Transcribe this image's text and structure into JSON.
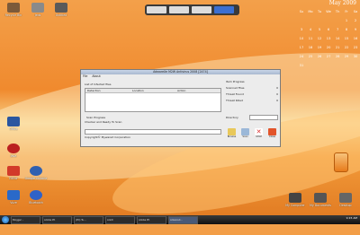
{
  "desktop": {
    "top_icons": [
      {
        "label": "Recycle Bin",
        "color": "#7c5a3a"
      },
      {
        "label": "Jeds",
        "color": "#8a8a8a"
      },
      {
        "label": "Untitled",
        "color": "#5a5a5a"
      }
    ],
    "left_icons": [
      {
        "label": "Office",
        "color": "#2a56a0"
      },
      {
        "label": "",
        "color": "#3b3b3b"
      },
      {
        "label": "",
        "color": "#3a6cc7"
      },
      {
        "label": "Vuze",
        "color": "#2a69c9"
      },
      {
        "label": "Java",
        "color": "#bb2020"
      },
      {
        "label": "Word",
        "color": "#7a7a7a"
      },
      {
        "label": "Editor",
        "color": "#d23a2a"
      },
      {
        "label": "Google Chrome",
        "color": "#3060b0"
      },
      {
        "label": "Bluetooth",
        "color": "#2f62c8"
      },
      {
        "label": "Zoom",
        "color": "#b22f2f"
      },
      {
        "label": "",
        "color": "#2d5fa7"
      }
    ],
    "bottom_right_icons": [
      {
        "label": "My Computer",
        "color": "#444"
      },
      {
        "label": "My Documents",
        "color": "#555"
      },
      {
        "label": "Desktop",
        "color": "#666"
      }
    ]
  },
  "calendar": {
    "month": "May 2009",
    "headers": [
      "Su",
      "Mo",
      "Tu",
      "We",
      "Th",
      "Fr",
      "Sa"
    ],
    "weeks": [
      [
        "",
        "",
        "",
        "",
        "",
        "1",
        "2"
      ],
      [
        "3",
        "4",
        "5",
        "6",
        "7",
        "8",
        "9"
      ],
      [
        "10",
        "11",
        "12",
        "13",
        "14",
        "15",
        "16"
      ],
      [
        "17",
        "18",
        "19",
        "20",
        "21",
        "22",
        "23"
      ],
      [
        "24",
        "25",
        "26",
        "27",
        "28",
        "29",
        "30"
      ],
      [
        "31",
        "",
        "",
        "",
        "",
        "",
        ""
      ]
    ]
  },
  "app": {
    "title": "AdwareXe M2W Antivirus 2008 [2474]",
    "menu": [
      "File",
      "About"
    ],
    "list_title": "List of Infected files",
    "columns": [
      "Detection",
      "Location",
      "Action"
    ],
    "scan_progress_label": "Scan Progress",
    "status": "Checker and Ready To Scan",
    "copyright": "Copyright© MywareX Corporation",
    "stats_title": "Item Progress",
    "stats": [
      {
        "label": "Scanned Files",
        "value": "0"
      },
      {
        "label": "Threat Found",
        "value": "0"
      },
      {
        "label": "Threat Killed",
        "value": "0"
      }
    ],
    "directory_label": "Directory",
    "buttons": [
      {
        "label": "Browse",
        "color": "#e8c85a"
      },
      {
        "label": "Scan",
        "color": "#9bb8d8"
      },
      {
        "label": "STOP",
        "color": "#d33"
      },
      {
        "label": "Close",
        "color": "#e2542a"
      }
    ]
  },
  "taskbar": {
    "items": [
      "",
      "Blogger -",
      "Adobe Ph",
      "(PC) Tu...",
      "Ankit",
      "Adobe Ph",
      "AdwareX..."
    ],
    "active_index": 6,
    "clock": "9:15 AM"
  }
}
